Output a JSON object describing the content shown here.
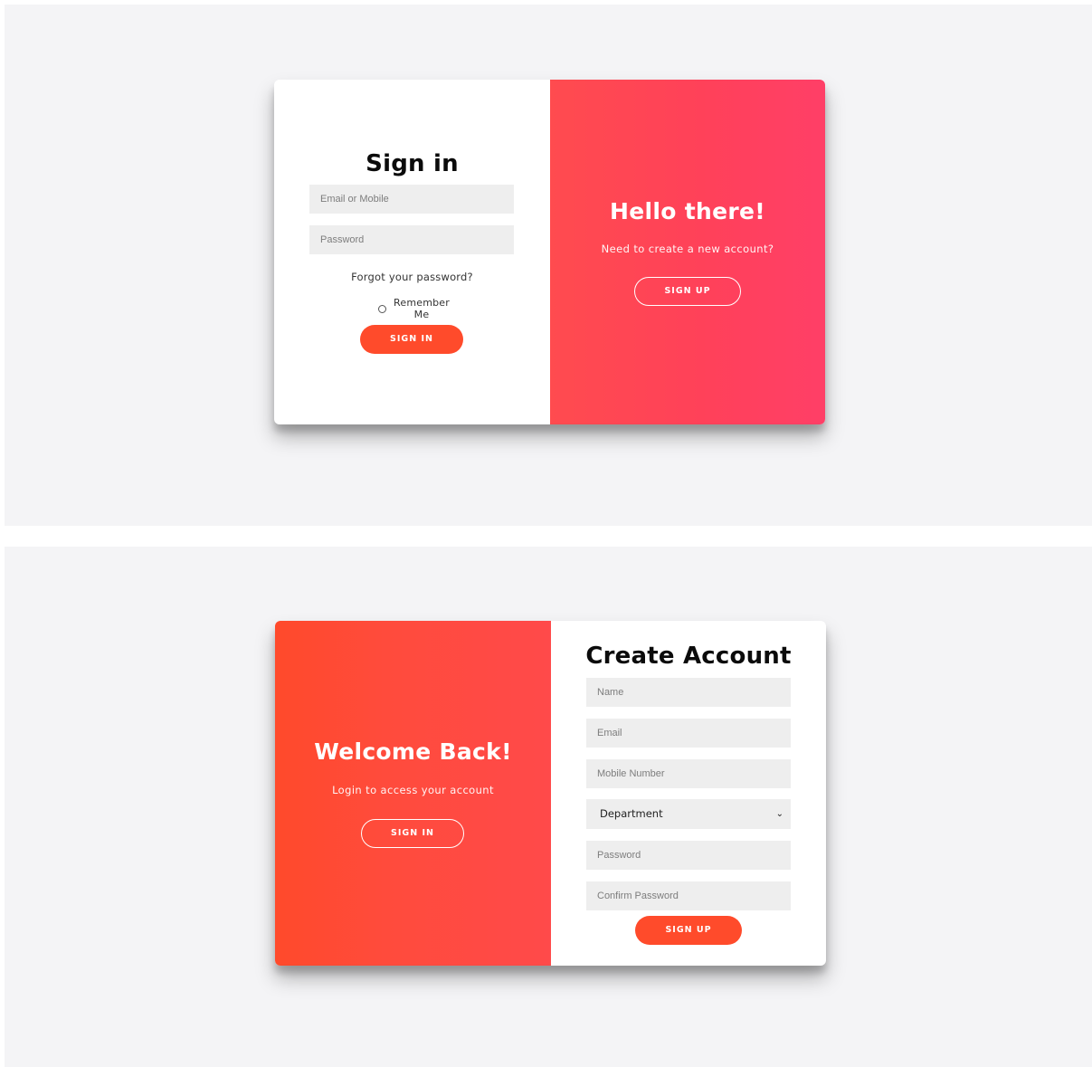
{
  "signin_view": {
    "form": {
      "title": "Sign in",
      "email_placeholder": "Email or Mobile",
      "password_placeholder": "Password",
      "forgot_link": "Forgot your password?",
      "remember_label": "Remember Me",
      "remember_checked": false,
      "submit_label": "SIGN IN"
    },
    "overlay": {
      "title": "Hello there!",
      "subtitle": "Need to create a new account?",
      "button_label": "SIGN UP"
    }
  },
  "signup_view": {
    "overlay": {
      "title": "Welcome Back!",
      "subtitle": "Login to access your account",
      "button_label": "SIGN IN"
    },
    "form": {
      "title": "Create Account",
      "name_placeholder": "Name",
      "email_placeholder": "Email",
      "mobile_placeholder": "Mobile Number",
      "department_selected": "Department",
      "password_placeholder": "Password",
      "confirm_password_placeholder": "Confirm Password",
      "submit_label": "SIGN UP"
    }
  },
  "colors": {
    "accent": "#ff4b2b",
    "gradient_pink": "#ff416c",
    "panel_background": "#f4f4f6",
    "input_background": "#eeeeee"
  },
  "icons": {
    "select_arrow": "chevron-down-icon",
    "remember_toggle": "radio-icon"
  }
}
